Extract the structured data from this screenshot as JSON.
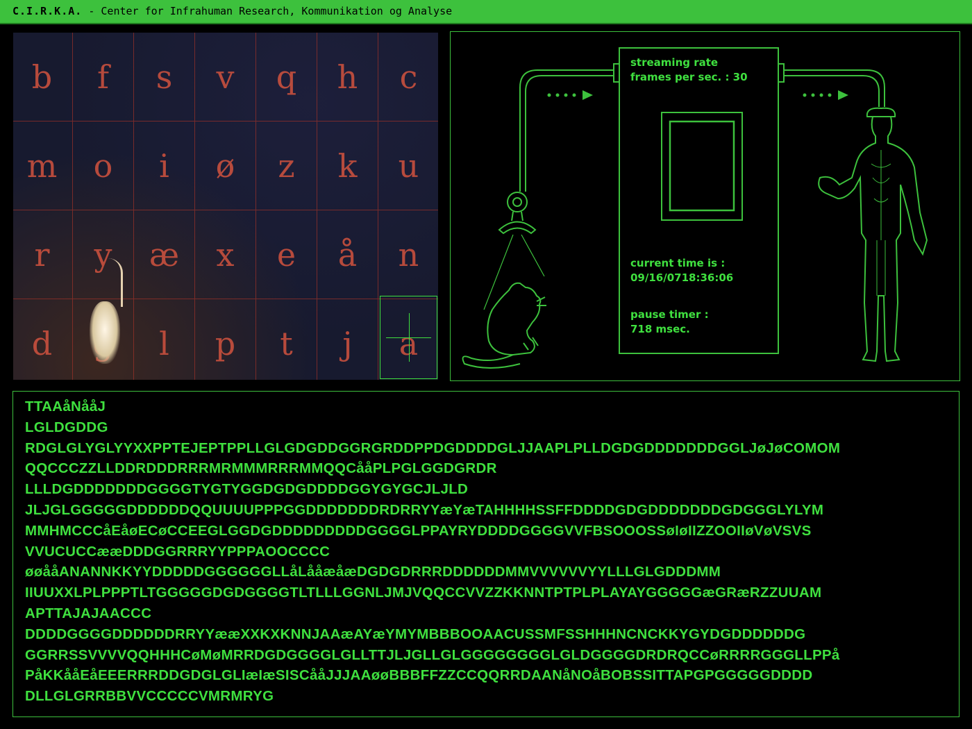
{
  "header": {
    "brand": "C.I.R.K.A.",
    "subtitle": " - Center for Infrahuman Research, Kommunikation og Analyse"
  },
  "camera": {
    "letters": [
      [
        "b",
        "f",
        "s",
        "v",
        "q",
        "h",
        "c"
      ],
      [
        "m",
        "o",
        "i",
        "ø",
        "z",
        "k",
        "u"
      ],
      [
        "r",
        "y",
        "æ",
        "x",
        "e",
        "å",
        "n"
      ],
      [
        "d",
        "g",
        "l",
        "p",
        "t",
        "j",
        "a"
      ]
    ]
  },
  "diagram": {
    "streaming_label": "streaming rate",
    "fps_label": "frames per sec. : 30",
    "time_label": "current time is :",
    "time_value": "09/16/0718:36:06",
    "pause_label": "pause timer :",
    "pause_value": "718 msec."
  },
  "output": {
    "lines": [
      "TTAAåNååJ",
      "LGLDGDDG",
      "RDGLGLYGLYYXXPPTEJEPTPPLLGLGDGDDGGRGRDDPPDGDDDDGLJJAAPLPLLDGDGDDDDDDDGGLJøJøCOMOM",
      "QQCCCZZLLDDRDDDRRRMRMMMRRRMMQQCååPLPGLGGDGRDR",
      "LLLDGDDDDDDDGGGGTYGTYGGDGDGDDDDGGYGYGCJLJLD",
      "JLJGLGGGGGDDDDDDQQUUUUPPPGGDDDDDDDRDRRYYæYæTAHHHHSSFFDDDDGDGDDDDDDDGDGGGLYLYM",
      "MMHMCCCåEåøECøCCEEGLGGDGDDDDDDDDDGGGGLPPAYRYDDDDGGGGVVFBSOOOSSøIøIIZZOOIIøVøVSVS",
      "VVUCUCCææDDDGGRRRYYPPPAOOCCCC",
      "øøååANANNKKYYDDDDDGGGGGGLLåLååæåæDGDGDRRRDDDDDDMMVVVVVVYYLLLGLGDDDMM",
      "IIUUXXLPLPPPTLTGGGGGDGDGGGGTLTLLLGGNLJMJVQQCCVVZZKKNNTPTPLPLAYAYGGGGGæGRæRZZUUAM",
      "APTTAJAJAACCC",
      "DDDDGGGGDDDDDDRRYYææXXKXKNNJAAæAYæYMYMBBBOOAACUSSMFSSHHHNCNCKKYGYDGDDDDDDG",
      "GGRRSSVVVVQQHHHCøMøMRRDGDGGGGLGLLTTJLJGLLGLGGGGGGGGLGLDGGGGDRDRQCCøRRRRGGGLLPPå",
      "PåKKååEåEEERRRDDGDGLGLIæIæSISCååJJJAAøøBBBFFZZCCQQRRDAANåNOåBOBSSITTAPGPGGGGGDDDD",
      "DLLGLGRRBBVVCCCCCVMRMRYG"
    ]
  },
  "colors": {
    "accent": "#3dc13d",
    "text_green": "#3fe03f",
    "grid_letter": "#c8503e"
  }
}
